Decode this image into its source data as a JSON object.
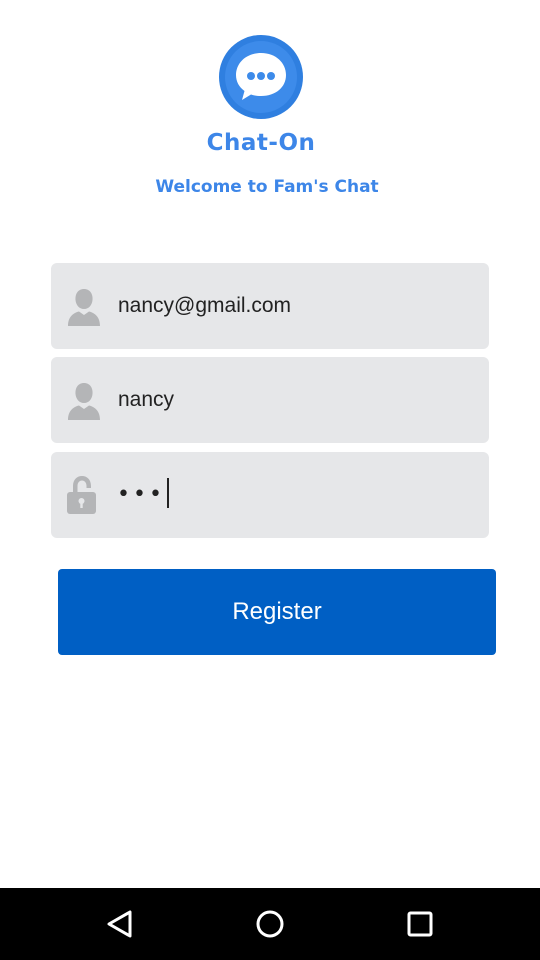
{
  "app": {
    "title": "Chat-On",
    "subtitle": "Welcome to Fam's Chat",
    "logo_icon": "chat-bubble-icon"
  },
  "form": {
    "email": {
      "value": "nancy@gmail.com",
      "icon": "user-icon"
    },
    "username": {
      "value": "nancy",
      "icon": "user-icon"
    },
    "password": {
      "masked_value": "•••",
      "icon": "lock-icon",
      "focused": true
    },
    "register_label": "Register"
  },
  "navbar": {
    "back_icon": "back-triangle-icon",
    "home_icon": "home-circle-icon",
    "recents_icon": "recents-square-icon"
  },
  "colors": {
    "accent": "#3d86e8",
    "button": "#005fc4",
    "field_bg": "#e6e7e9",
    "icon_gray": "#b4b5b7",
    "navbar": "#000000"
  }
}
